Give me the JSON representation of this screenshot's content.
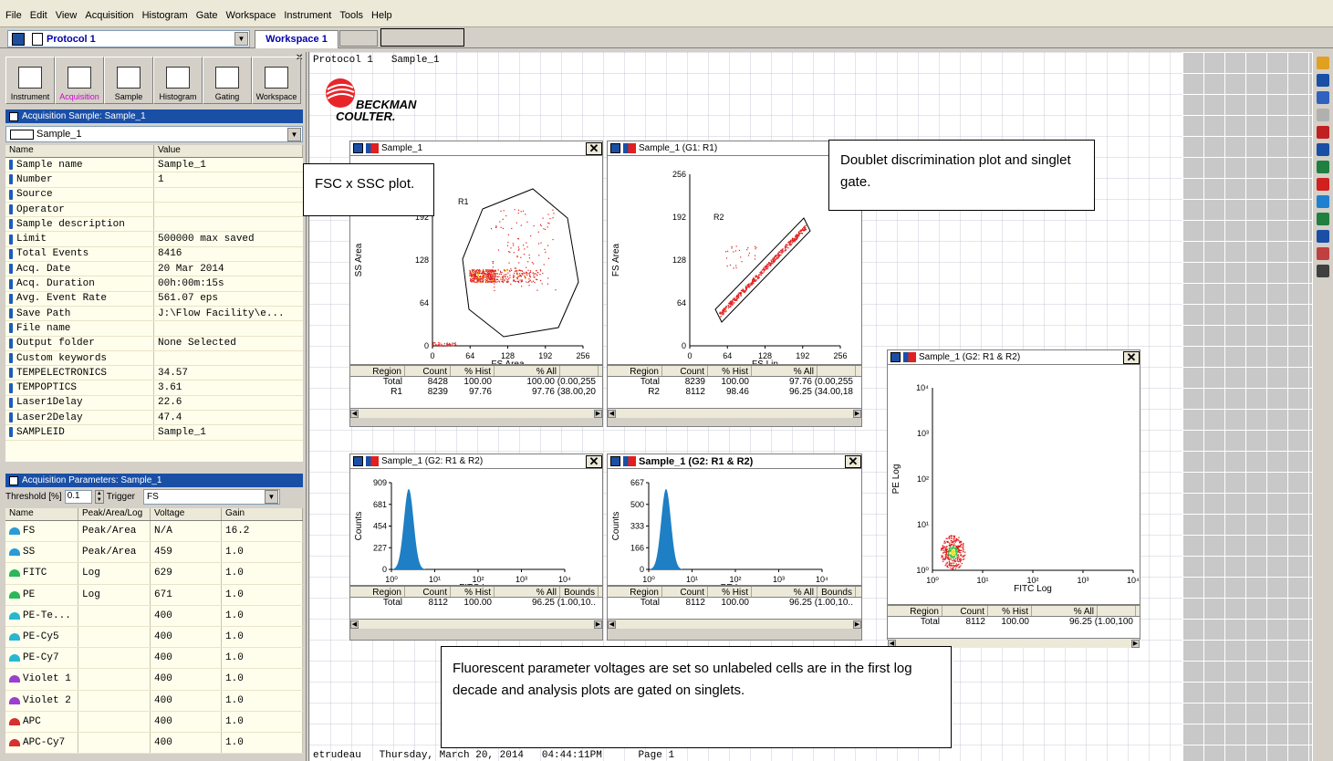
{
  "menu": [
    "File",
    "Edit",
    "View",
    "Acquisition",
    "Histogram",
    "Gate",
    "Workspace",
    "Instrument",
    "Tools",
    "Help"
  ],
  "protocol": {
    "name": "Protocol 1",
    "workspace_tab": "Workspace 1"
  },
  "tools": [
    {
      "label": "Instrument",
      "icon": "instrument-icon"
    },
    {
      "label": "Acquisition",
      "icon": "acquisition-icon"
    },
    {
      "label": "Sample",
      "icon": "sample-tubes-icon"
    },
    {
      "label": "Histogram",
      "icon": "histogram-icon"
    },
    {
      "label": "Gating",
      "icon": "gating-icon"
    },
    {
      "label": "Workspace",
      "icon": "workspace-icon"
    }
  ],
  "acq_sample": {
    "header": "Acquisition Sample: Sample_1",
    "selected": "Sample_1",
    "col_name": "Name",
    "col_value": "Value",
    "rows": [
      [
        "Sample name",
        "Sample_1"
      ],
      [
        "Number",
        "1"
      ],
      [
        "Source",
        ""
      ],
      [
        "Operator",
        ""
      ],
      [
        "Sample description",
        ""
      ],
      [
        "Limit",
        "500000 max saved"
      ],
      [
        "Total Events",
        "8416"
      ],
      [
        "Acq. Date",
        "20 Mar 2014"
      ],
      [
        "Acq. Duration",
        "00h:00m:15s"
      ],
      [
        "Avg. Event Rate",
        "561.07 eps"
      ],
      [
        "Save Path",
        "J:\\Flow Facility\\e..."
      ],
      [
        "File name",
        ""
      ],
      [
        "Output folder",
        "None Selected"
      ],
      [
        "Custom keywords",
        ""
      ],
      [
        "TEMPELECTRONICS",
        "34.57"
      ],
      [
        "TEMPOPTICS",
        "3.61"
      ],
      [
        "Laser1Delay",
        "22.6"
      ],
      [
        "Laser2Delay",
        "47.4"
      ],
      [
        "SAMPLEID",
        "Sample_1"
      ]
    ]
  },
  "acq_params": {
    "header": "Acquisition Parameters: Sample_1",
    "threshold_label": "Threshold [%]",
    "threshold_value": "0.1",
    "trigger_label": "Trigger",
    "trigger_value": "FS",
    "cols": [
      "Name",
      "Peak/Area/Log",
      "Voltage",
      "Gain"
    ],
    "rows": [
      {
        "name": "FS",
        "mode": "Peak/Area",
        "voltage": "N/A",
        "gain": "16.2",
        "color": "#2a9bd8"
      },
      {
        "name": "SS",
        "mode": "Peak/Area",
        "voltage": "459",
        "gain": "1.0",
        "color": "#2a9bd8"
      },
      {
        "name": "FITC",
        "mode": "Log",
        "voltage": "629",
        "gain": "1.0",
        "color": "#2ab85a"
      },
      {
        "name": "PE",
        "mode": "Log",
        "voltage": "671",
        "gain": "1.0",
        "color": "#2ab85a"
      },
      {
        "name": "PE-Te...",
        "mode": "",
        "voltage": "400",
        "gain": "1.0",
        "color": "#29b7d0"
      },
      {
        "name": "PE-Cy5",
        "mode": "",
        "voltage": "400",
        "gain": "1.0",
        "color": "#29b7d0"
      },
      {
        "name": "PE-Cy7",
        "mode": "",
        "voltage": "400",
        "gain": "1.0",
        "color": "#29b7d0"
      },
      {
        "name": "Violet 1",
        "mode": "",
        "voltage": "400",
        "gain": "1.0",
        "color": "#9a3fd0"
      },
      {
        "name": "Violet 2",
        "mode": "",
        "voltage": "400",
        "gain": "1.0",
        "color": "#9a3fd0"
      },
      {
        "name": "APC",
        "mode": "",
        "voltage": "400",
        "gain": "1.0",
        "color": "#d63030"
      },
      {
        "name": "APC-Cy7",
        "mode": "",
        "voltage": "400",
        "gain": "1.0",
        "color": "#d63030"
      }
    ]
  },
  "page": {
    "header": "Protocol 1   Sample_1",
    "footer": "etrudeau   Thursday, March 20, 2014   04:44:11PM      Page 1",
    "logo_line1": "BECKMAN",
    "logo_line2": "COULTER."
  },
  "plots": [
    {
      "title": "Sample_1",
      "xlabel": "FS Area",
      "ylabel": "SS Area",
      "region": "R1",
      "stat_cols": [
        "Region",
        "Count",
        "% Hist",
        "% All",
        ""
      ],
      "stat_rows": [
        [
          "Total",
          "8428",
          "100.00",
          "100.00  (0.00,255"
        ],
        [
          "R1",
          "8239",
          "97.76",
          "97.76  (38.00,20"
        ]
      ]
    },
    {
      "title": "Sample_1  (G1: R1)",
      "xlabel": "FS Lin",
      "ylabel": "FS Area",
      "region": "R2",
      "stat_cols": [
        "Region",
        "Count",
        "% Hist",
        "% All",
        ""
      ],
      "stat_rows": [
        [
          "Total",
          "8239",
          "100.00",
          "97.76  (0.00,255"
        ],
        [
          "R2",
          "8112",
          "98.46",
          "96.25  (34.00,18"
        ]
      ]
    },
    {
      "title": "Sample_1  (G2: R1 & R2)",
      "xlabel": "FITC Log",
      "ylabel": "Counts",
      "yticks": [
        "909",
        "681",
        "454",
        "227",
        "0"
      ],
      "stat_cols": [
        "Region",
        "Count",
        "% Hist",
        "% All",
        "Bounds"
      ],
      "stat_rows": [
        [
          "Total",
          "8112",
          "100.00",
          "96.25  (1.00,10.."
        ]
      ]
    },
    {
      "title": "Sample_1  (G2: R1 & R2)",
      "xlabel": "PE Log",
      "ylabel": "Counts",
      "yticks": [
        "667",
        "500",
        "333",
        "166",
        "0"
      ],
      "stat_cols": [
        "Region",
        "Count",
        "% Hist",
        "% All",
        "Bounds"
      ],
      "stat_rows": [
        [
          "Total",
          "8112",
          "100.00",
          "96.25  (1.00,10.."
        ]
      ]
    },
    {
      "title": "Sample_1  (G2: R1 & R2)",
      "xlabel": "FITC Log",
      "ylabel": "PE Log",
      "stat_cols": [
        "Region",
        "Count",
        "% Hist",
        "% All",
        ""
      ],
      "stat_rows": [
        [
          "Total",
          "8112",
          "100.00",
          "96.25  (1.00,100"
        ]
      ]
    }
  ],
  "lin_ticks": [
    "0",
    "64",
    "128",
    "192",
    "256"
  ],
  "log_ticks": [
    "10⁰",
    "10¹",
    "10²",
    "10³",
    "10⁴"
  ],
  "callouts": {
    "fsc": "FSC x SSC plot.",
    "doublet": "Doublet discrimination plot and singlet gate.",
    "fluor": "Fluorescent parameter voltages are set so unlabeled cells are in the first log decade and analysis plots are gated on singlets."
  }
}
